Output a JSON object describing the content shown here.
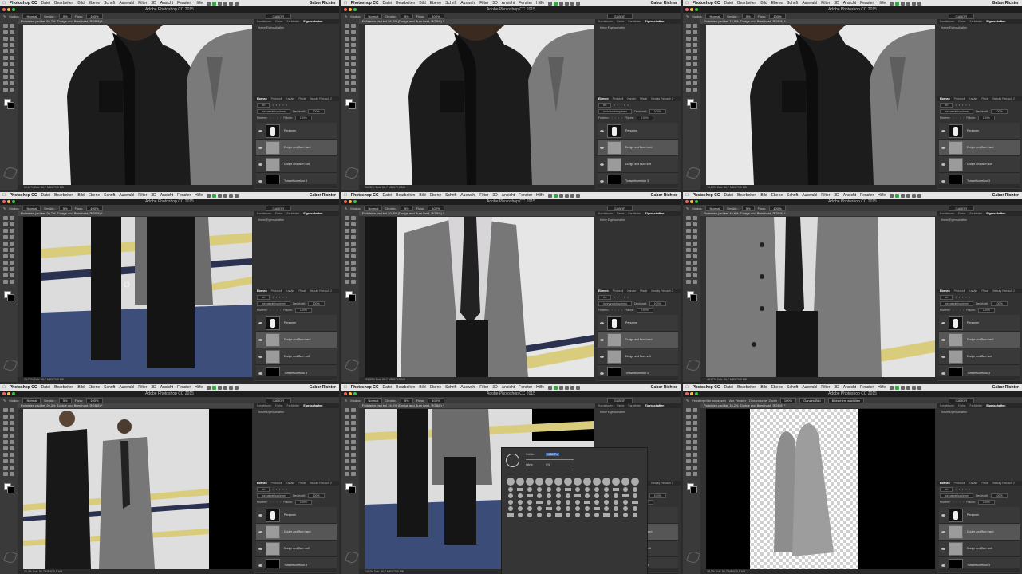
{
  "app_title": "Adobe Photoshop CC 2015",
  "menubar": {
    "apple": "",
    "app_name": "Photoshop CC",
    "items": [
      "Datei",
      "Bearbeiten",
      "Bild",
      "Ebene",
      "Schrift",
      "Auswahl",
      "Filter",
      "3D",
      "Ansicht",
      "Fenster",
      "Hilfe"
    ],
    "user": "Gabor Richter"
  },
  "options_bar": {
    "mode_label": "Modus:",
    "mode_value": "Normal",
    "opacity_label": "Deckkr.:",
    "opacity_value": "5%",
    "flow_label": "Fluss:",
    "flow_value": "100%",
    "workspace": "GABOR"
  },
  "panel_tabs_top": [
    "Korrekturen",
    "Farbe",
    "Farbfelder",
    "Eigenschaften"
  ],
  "properties_empty": "Keine Eigenschaften",
  "layers_panel": {
    "tabs": [
      "Ebenen",
      "Protokoll",
      "Kanäle",
      "Pfade",
      "Beauty Retusch 2"
    ],
    "filter_label": "Art",
    "blend_mode": "Ineinanderkopieren",
    "opacity_label": "Deckkraft:",
    "opacity_value": "100%",
    "lock_label": "Fixieren:",
    "fill_label": "Fläche:",
    "fill_value": "100%",
    "layers": [
      "Personen",
      "Dodge and Burn hard",
      "Dodge and Burn soft",
      "Tonwertkorrektur 3"
    ]
  },
  "tiles": [
    {
      "doc_title": "Polizisten.psd bei 66,7% (Dodge and Burn hard, RGB/8) *",
      "zoom": "66,67%",
      "doc_info": "Dok: 86,7 MB/670,5 MB",
      "scene": "jackets-closeup"
    },
    {
      "doc_title": "Polizisten.psd bei 56,3% (Dodge and Burn hard, RGB/8) *",
      "zoom": "56,32%",
      "doc_info": "Dok: 86,7 MB/670,5 MB",
      "scene": "jackets-closeup"
    },
    {
      "doc_title": "Polizisten.psd bei 74,8% (Dodge and Burn hard, RGB/8) *",
      "zoom": "74,83%",
      "doc_info": "Dok: 86,7 MB/670,5 MB",
      "scene": "jackets-closeup"
    },
    {
      "doc_title": "Polizisten.psd bei 20,7% (Dodge and Burn hard, RGB/8) *",
      "zoom": "20,73%",
      "doc_info": "Dok: 86,7 MB/670,5 MB",
      "scene": "legs-street"
    },
    {
      "doc_title": "Polizisten.psd bei 33,3% (Dodge and Burn hard, RGB/8) *",
      "zoom": "33,33%",
      "doc_info": "Dok: 86,7 MB/670,5 MB",
      "scene": "coat-tie"
    },
    {
      "doc_title": "Polizisten.psd bei 48,6% (Dodge and Burn hard, RGB/8) *",
      "zoom": "48,57%",
      "doc_info": "Dok: 86,7 MB/670,5 MB",
      "scene": "coat-close"
    },
    {
      "doc_title": "Polizisten.psd bei 20,3% (Dodge and Burn hard, RGB/8) *",
      "zoom": "20,3%",
      "doc_info": "Dok: 86,7 MB/670,5 MB",
      "scene": "full-figures"
    },
    {
      "doc_title": "Polizisten.psd bei 16,4% (Dodge and Burn hard, RGB/8) *",
      "zoom": "16,4%",
      "doc_info": "Dok: 86,7 MB/670,5 MB",
      "scene": "brush-picker"
    },
    {
      "doc_title": "Polizisten.psd bei 16,2% (Dodge and Burn hard, RGB/8) *",
      "zoom": "16,2%",
      "doc_info": "Dok: 86,7 MB/670,5 MB",
      "scene": "transparent-silhouette"
    }
  ],
  "tile9_options": {
    "fit_windows": "Fenstergröße anpassen",
    "all_windows": "Alle Fenster",
    "scrubby_zoom": "Dynamischer Zoom",
    "zoom_pct": "100%",
    "fit_screen": "Ganzes Bild",
    "fill_screen": "Bildschirm ausfüllen"
  },
  "brush_picker": {
    "size_label": "Größe:",
    "size_value": "1250 Px",
    "hardness_label": "Härte:",
    "hardness_value": "0%"
  },
  "colors": {
    "menubar_bg": "#e4e4e4",
    "ui_dark": "#313131",
    "panel_dark": "#323232",
    "accent_blue": "#3b6bb8",
    "tape_yellow": "#d9cc7c",
    "tape_navy": "#2b3250"
  }
}
